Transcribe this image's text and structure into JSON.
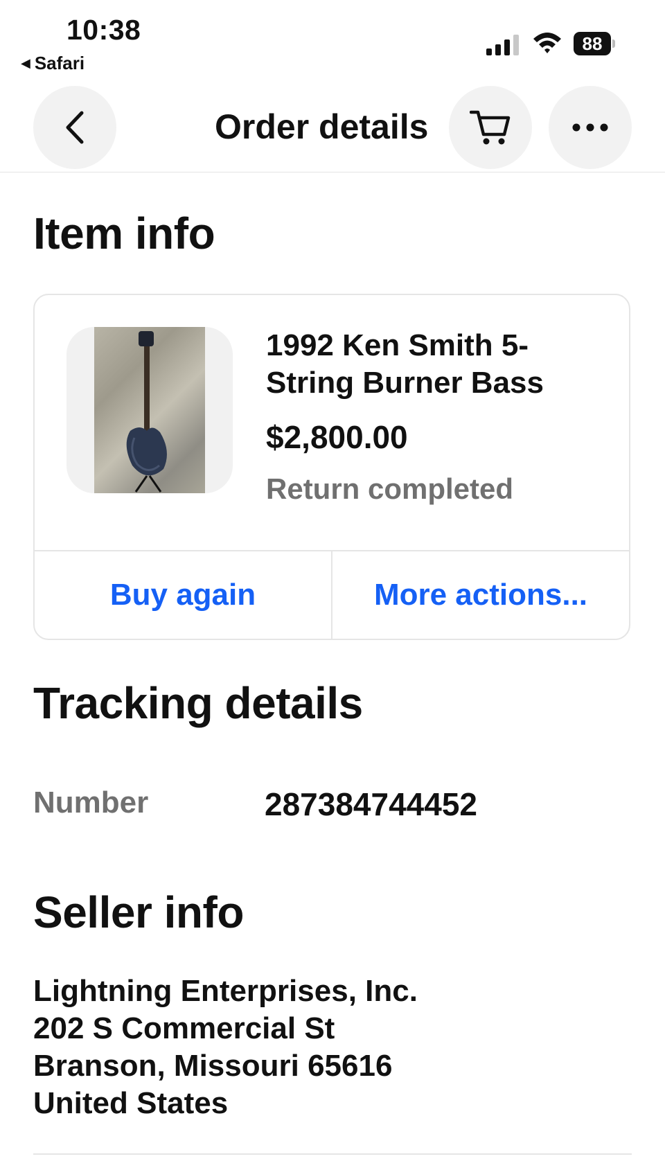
{
  "status_bar": {
    "time": "10:38",
    "back_app_label": "Safari",
    "battery_level": "88",
    "signal_bars": 3,
    "wifi": true
  },
  "header": {
    "title": "Order details",
    "icons": [
      "chevron-left-icon",
      "cart-icon",
      "more-horizontal-icon"
    ]
  },
  "item_info": {
    "heading": "Item info",
    "item": {
      "title": "1992 Ken Smith 5-String Burner Bass",
      "price": "$2,800.00",
      "status": "Return completed"
    },
    "actions": {
      "buy_again": "Buy again",
      "more_actions": "More actions..."
    }
  },
  "tracking": {
    "heading": "Tracking details",
    "number_label": "Number",
    "number_value": "287384744452"
  },
  "seller": {
    "heading": "Seller info",
    "lines": [
      "Lightning Enterprises, Inc.",
      "202 S Commercial St",
      "Branson, Missouri 65616",
      "United States"
    ]
  },
  "colors": {
    "link_blue": "#1560f5",
    "muted_gray": "#707070",
    "divider": "#e5e5e5",
    "button_bg": "#f2f2f2"
  }
}
